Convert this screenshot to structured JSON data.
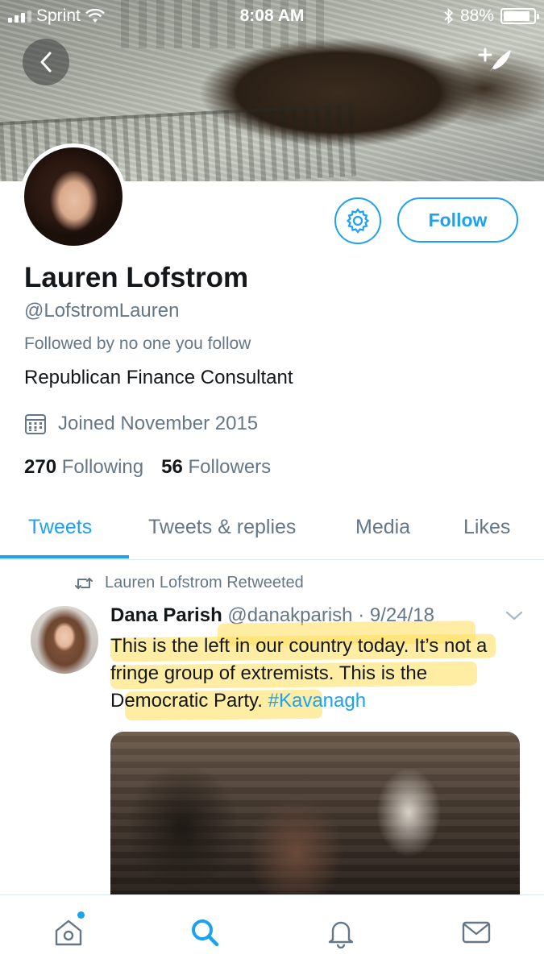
{
  "status_bar": {
    "carrier": "Sprint",
    "time": "8:08 AM",
    "battery": "88%",
    "battery_level": 0.88
  },
  "header": {
    "back_icon": "chevron-left-icon",
    "compose_icon": "compose-tweet-icon"
  },
  "profile": {
    "display_name": "Lauren Lofstrom",
    "handle": "@LofstromLauren",
    "followed_by": "Followed by no one you follow",
    "bio": "Republican Finance Consultant",
    "joined": "Joined November 2015",
    "following_count": "270",
    "following_label": "Following",
    "followers_count": "56",
    "followers_label": "Followers",
    "follow_button": "Follow",
    "settings_icon": "gear-icon"
  },
  "tabs": [
    {
      "label": "Tweets",
      "active": true
    },
    {
      "label": "Tweets & replies",
      "active": false
    },
    {
      "label": "Media",
      "active": false
    },
    {
      "label": "Likes",
      "active": false
    }
  ],
  "tweet": {
    "retweet_context": "Lauren Lofstrom Retweeted",
    "author_name": "Dana Parish",
    "author_handle": "@danakparish",
    "separator": " · ",
    "date": "9/24/18",
    "text": "This is the left in our country today. It’s not a fringe group of extremists. This is the Democratic Party.",
    "hashtag": "#Kavanagh",
    "highlight_color": "#ffde5a"
  },
  "bottom_nav": [
    {
      "icon": "home-icon",
      "has_notification_dot": true
    },
    {
      "icon": "search-icon",
      "active": true
    },
    {
      "icon": "bell-icon"
    },
    {
      "icon": "mail-icon"
    }
  ],
  "colors": {
    "accent": "#1da1f2",
    "secondary_text": "#657786",
    "primary_text": "#14171a"
  }
}
